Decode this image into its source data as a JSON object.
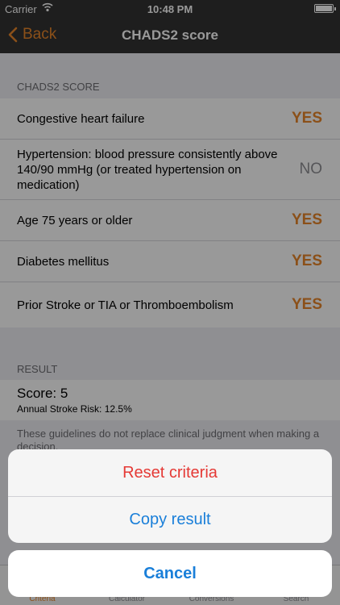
{
  "status_bar": {
    "carrier": "Carrier",
    "time": "10:48 PM"
  },
  "nav": {
    "back_label": "Back",
    "title": "CHADS2 score"
  },
  "criteria_section": {
    "header": "CHADS2 SCORE",
    "items": [
      {
        "label": "Congestive heart failure",
        "value": "YES"
      },
      {
        "label": "Hypertension: blood pressure consistently above 140/90 mmHg (or treated hypertension on medication)",
        "value": "NO"
      },
      {
        "label": "Age 75 years or older",
        "value": "YES"
      },
      {
        "label": "Diabetes mellitus",
        "value": "YES"
      },
      {
        "label": "Prior Stroke or TIA or Thromboembolism",
        "value": "YES"
      }
    ]
  },
  "result_section": {
    "header": "RESULT",
    "score": "Score: 5",
    "risk": "Annual Stroke Risk: 12.5%",
    "disclaimer": "These guidelines do not replace clinical judgment when making a decision."
  },
  "tabs": [
    {
      "label": "Criteria"
    },
    {
      "label": "Calculator"
    },
    {
      "label": "Conversions"
    },
    {
      "label": "Search"
    }
  ],
  "action_sheet": {
    "reset_label": "Reset criteria",
    "copy_label": "Copy result",
    "cancel_label": "Cancel"
  },
  "colors": {
    "accent": "#e8862a",
    "destructive": "#e53935",
    "action": "#1a7fd9"
  }
}
